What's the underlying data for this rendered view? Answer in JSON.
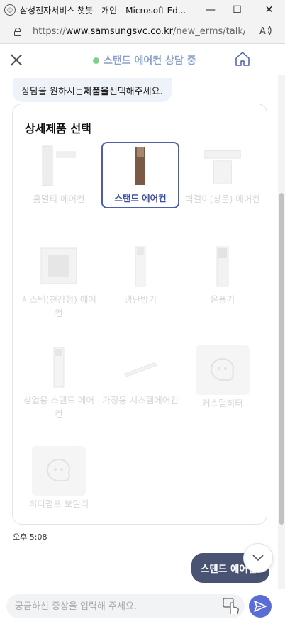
{
  "browser": {
    "title": "삼성전자서비스 챗봇 - 개인 - Microsoft Ed...",
    "url_prefix": "https://",
    "url_domain": "www.samsungsvc.co.kr",
    "url_path": "/new_erms/talk/...",
    "readaloud_label": "A)",
    "minimize_label": "—",
    "restore_label": "☐",
    "close_label": "✕"
  },
  "chat_header": {
    "status": "스탠드 에어컨 상담 중",
    "status_color": "#7bd389"
  },
  "messages": {
    "bot_prompt_pre": "상담을 원하시는 ",
    "bot_prompt_bold": "제품을",
    "bot_prompt_post": " 선택해주세요.",
    "card_title": "상세제품 선택",
    "products": [
      {
        "label": "홈멀티 에어컨",
        "icon": "home-multi-aircon-icon"
      },
      {
        "label": "스탠드 에어컨",
        "icon": "stand-aircon-icon",
        "selected": true
      },
      {
        "label": "벽걸이(창문) 에어컨",
        "icon": "wall-aircon-icon"
      },
      {
        "label": "시스템(천장형) 에어컨",
        "icon": "ceiling-aircon-icon"
      },
      {
        "label": "냉난방기",
        "icon": "heater-cooler-icon"
      },
      {
        "label": "온풍기",
        "icon": "hot-air-heater-icon"
      },
      {
        "label": "상업용 스탠드 에어컨",
        "icon": "commercial-stand-aircon-icon"
      },
      {
        "label": "가정용 시스템에어컨",
        "icon": "home-system-aircon-icon"
      },
      {
        "label": "커스텀히터",
        "icon": "custom-heater-icon"
      },
      {
        "label": "히터펌프 보일러",
        "icon": "heatpump-boiler-icon"
      }
    ],
    "time": "오후 5:08",
    "user_message": "스탠드 에어컨"
  },
  "input": {
    "placeholder": "궁금하신 증상을 입력해 주세요."
  },
  "colors": {
    "accent": "#4c5fa8",
    "send_button": "#5a6dd4",
    "user_bubble": "#4a5472",
    "bot_bubble": "#eef2f9"
  }
}
